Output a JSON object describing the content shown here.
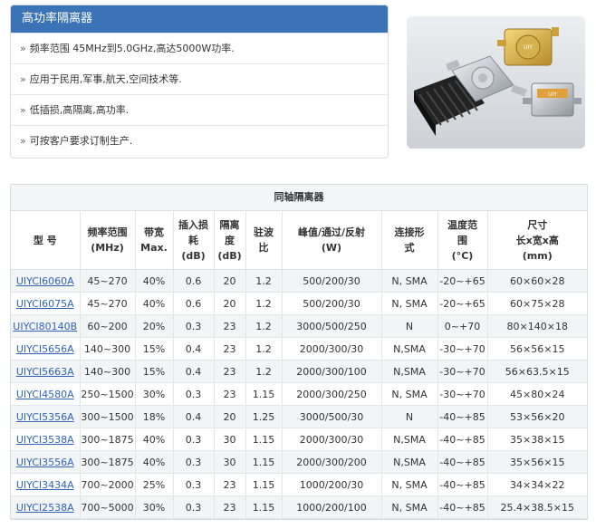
{
  "panel": {
    "title": "高功率隔离器",
    "features": [
      "频率范围 45MHz到5.0GHz,高达5000W功率.",
      "应用于民用,军事,航天,空间技术等.",
      "低插损,高隔离,高功率.",
      "可按客户要求订制生产."
    ]
  },
  "table": {
    "title": "同轴隔离器",
    "headers": [
      [
        "型 号"
      ],
      [
        "频率范围",
        "(MHz)"
      ],
      [
        "带宽",
        "Max."
      ],
      [
        "插入损",
        "耗",
        "(dB)"
      ],
      [
        "隔离",
        "度",
        "(dB)"
      ],
      [
        "驻波",
        "比"
      ],
      [
        "峰值/通过/反射",
        "(W)"
      ],
      [
        "连接形",
        "式"
      ],
      [
        "温度范",
        "围",
        "(°C)"
      ],
      [
        "尺寸",
        "长x宽x高",
        "(mm)"
      ]
    ],
    "rows": [
      [
        "UIYCI6060A",
        "45~270",
        "40%",
        "0.6",
        "20",
        "1.2",
        "500/200/30",
        "N, SMA",
        "-20~+65",
        "60×60×28"
      ],
      [
        "UIYCI6075A",
        "45~270",
        "40%",
        "0.6",
        "20",
        "1.2",
        "500/200/30",
        "N, SMA",
        "-20~+65",
        "60×75×28"
      ],
      [
        "UIYCI80140B",
        "60~200",
        "20%",
        "0.3",
        "23",
        "1.2",
        "3000/500/250",
        "N",
        "0~+70",
        "80×140×18"
      ],
      [
        "UIYCI5656A",
        "140~300",
        "15%",
        "0.4",
        "23",
        "1.2",
        "2000/300/30",
        "N,SMA",
        "-30~+70",
        "56×56×15"
      ],
      [
        "UIYCI5663A",
        "140~300",
        "15%",
        "0.4",
        "23",
        "1.2",
        "2000/300/100",
        "N,SMA",
        "-30~+70",
        "56×63.5×15"
      ],
      [
        "UIYCI4580A",
        "250~1500",
        "30%",
        "0.3",
        "23",
        "1.15",
        "2000/300/250",
        "N, SMA",
        "-30~+70",
        "45×80×24"
      ],
      [
        "UIYCI5356A",
        "300~1500",
        "18%",
        "0.4",
        "20",
        "1.25",
        "3000/500/30",
        "N",
        "-40~+85",
        "53×56×20"
      ],
      [
        "UIYCI3538A",
        "300~1875",
        "40%",
        "0.3",
        "30",
        "1.15",
        "2000/300/30",
        "N,SMA",
        "-40~+85",
        "35×38×15"
      ],
      [
        "UIYCI3556A",
        "300~1875",
        "40%",
        "0.3",
        "30",
        "1.15",
        "2000/300/200",
        "N,SMA",
        "-40~+85",
        "35×56×15"
      ],
      [
        "UIYCI3434A",
        "700~2000",
        "25%",
        "0.3",
        "23",
        "1.15",
        "1000/200/30",
        "N, SMA",
        "-40~+85",
        "34×34×22"
      ],
      [
        "UIYCI2538A",
        "700~5000",
        "30%",
        "0.3",
        "23",
        "1.15",
        "1000/200/100",
        "N, SMA",
        "-40~+85",
        "25.4×38.5×15"
      ]
    ]
  },
  "colors": {
    "header_blue": "#3a73b6",
    "link_blue": "#2f64b8"
  }
}
